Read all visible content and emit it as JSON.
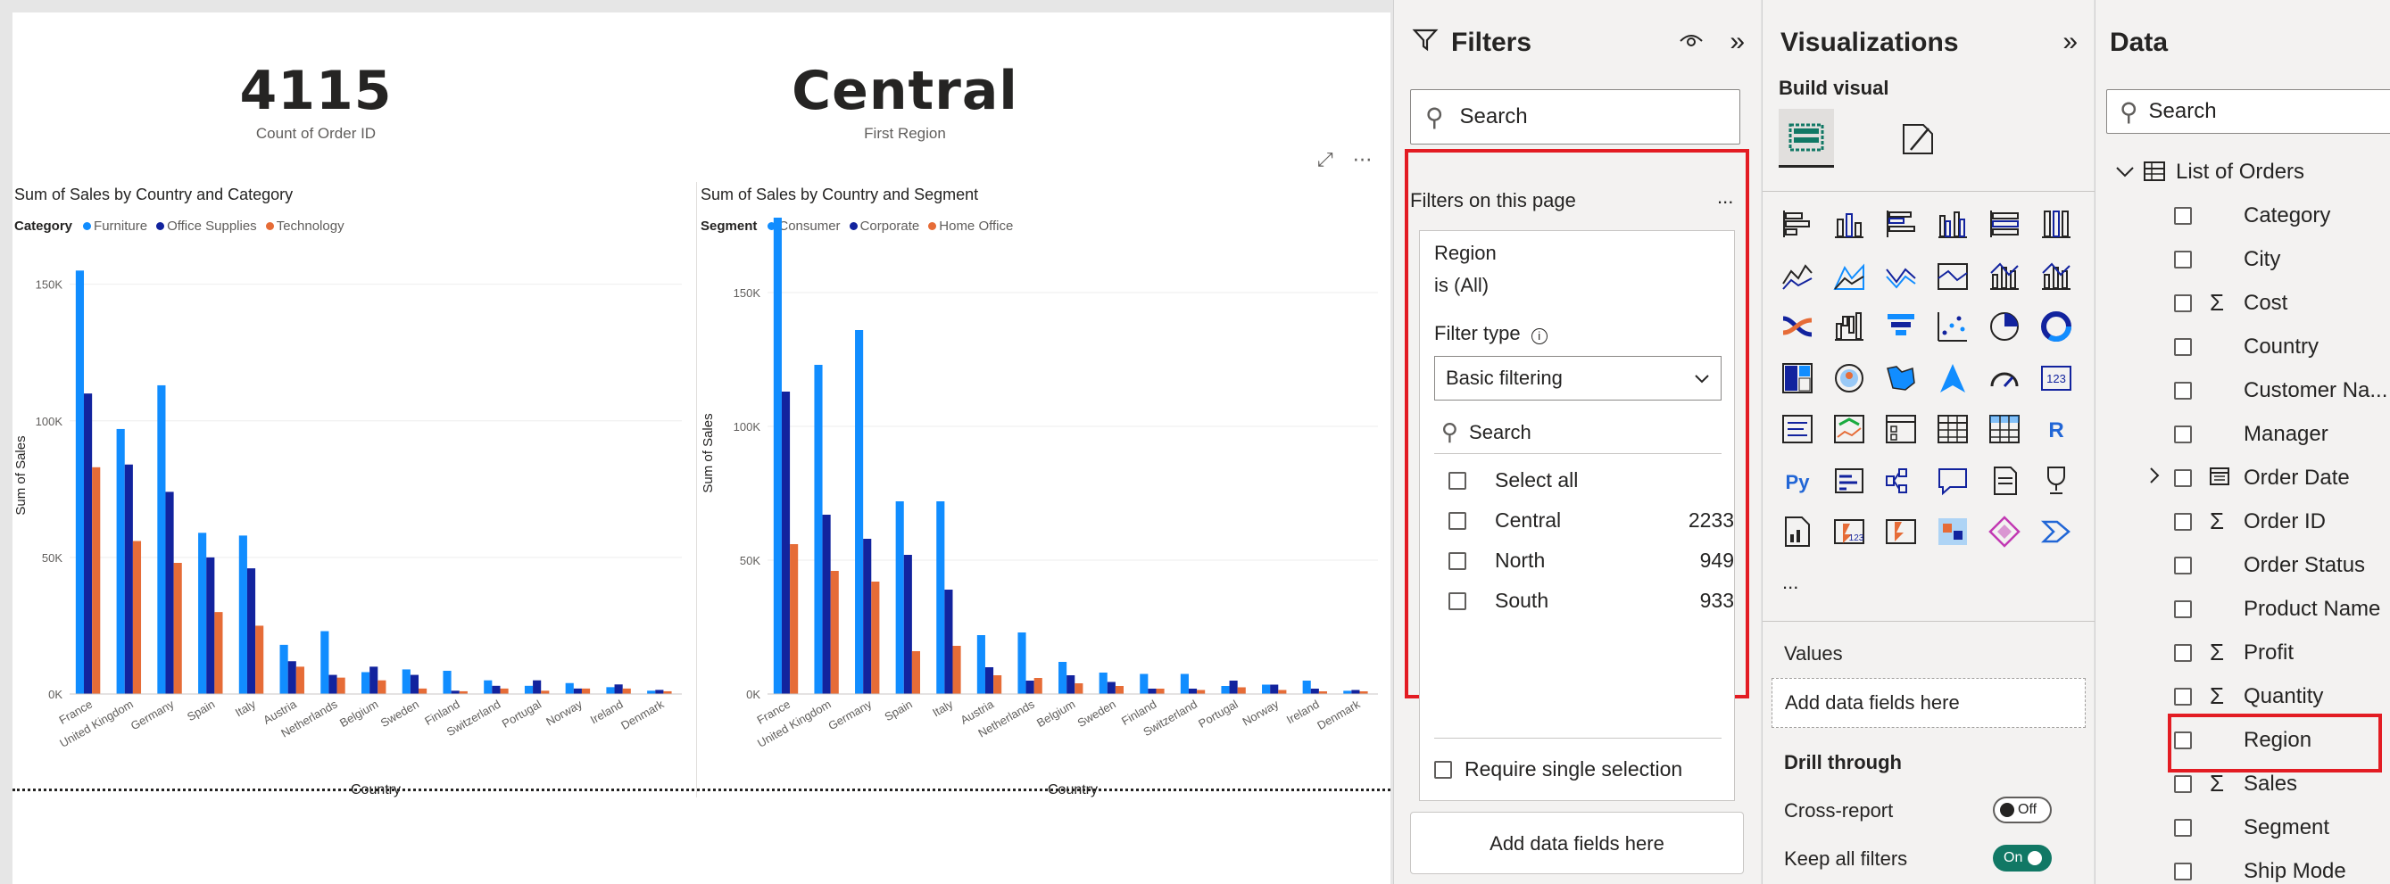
{
  "cards": [
    {
      "value": "4115",
      "label": "Count of Order ID"
    },
    {
      "value": "Central",
      "label": "First Region"
    }
  ],
  "colors": {
    "series1": "#118dff",
    "series2": "#12239e",
    "series3": "#e66c37",
    "accent_red": "#e31c23",
    "toggle_on": "#117865"
  },
  "chart_data": [
    {
      "type": "bar",
      "title": "Sum of Sales by Country and Category",
      "legend_title": "Category",
      "xlabel": "Country",
      "ylabel": "Sum of Sales",
      "ylim": [
        0,
        160000
      ],
      "yticks": [
        "0K",
        "50K",
        "100K",
        "150K"
      ],
      "categories": [
        "France",
        "United Kingdom",
        "Germany",
        "Spain",
        "Italy",
        "Austria",
        "Netherlands",
        "Belgium",
        "Sweden",
        "Finland",
        "Switzerland",
        "Portugal",
        "Norway",
        "Ireland",
        "Denmark"
      ],
      "series": [
        {
          "name": "Furniture",
          "values": [
            155000,
            97000,
            113000,
            59000,
            58000,
            18000,
            23000,
            8000,
            9000,
            8500,
            5000,
            3000,
            4000,
            2500,
            1200
          ]
        },
        {
          "name": "Office Supplies",
          "values": [
            110000,
            84000,
            74000,
            50000,
            46000,
            12000,
            7000,
            10000,
            7000,
            1200,
            3000,
            5000,
            2000,
            3500,
            1500
          ]
        },
        {
          "name": "Technology",
          "values": [
            83000,
            56000,
            48000,
            30000,
            25000,
            10000,
            6000,
            5000,
            2000,
            1000,
            2000,
            1200,
            2000,
            2000,
            1000
          ]
        }
      ]
    },
    {
      "type": "bar",
      "title": "Sum of Sales by Country and Segment",
      "legend_title": "Segment",
      "xlabel": "Country",
      "ylabel": "Sum of Sales",
      "ylim": [
        0,
        180000
      ],
      "yticks": [
        "0K",
        "50K",
        "100K",
        "150K"
      ],
      "categories": [
        "France",
        "United Kingdom",
        "Germany",
        "Spain",
        "Italy",
        "Austria",
        "Netherlands",
        "Belgium",
        "Sweden",
        "Finland",
        "Switzerland",
        "Portugal",
        "Norway",
        "Ireland",
        "Denmark"
      ],
      "series": [
        {
          "name": "Consumer",
          "values": [
            178000,
            123000,
            136000,
            72000,
            72000,
            22000,
            23000,
            12000,
            8000,
            7500,
            7500,
            3000,
            3500,
            5000,
            1200
          ]
        },
        {
          "name": "Corporate",
          "values": [
            113000,
            67000,
            58000,
            52000,
            39000,
            10000,
            5000,
            7000,
            4500,
            2000,
            2000,
            5000,
            3500,
            2000,
            1500
          ]
        },
        {
          "name": "Home Office",
          "values": [
            56000,
            46000,
            42000,
            16000,
            18000,
            7000,
            6000,
            4000,
            3000,
            2000,
            1500,
            2500,
            1500,
            1000,
            1000
          ]
        }
      ]
    }
  ],
  "filters": {
    "title": "Filters",
    "search_placeholder": "Search",
    "section_title": "Filters on this page",
    "more": "...",
    "card": {
      "field": "Region",
      "state": "is (All)",
      "filter_type_label": "Filter type",
      "filter_type_value": "Basic filtering",
      "search_placeholder": "Search",
      "select_all": "Select all",
      "items": [
        {
          "label": "Central",
          "count": "2233"
        },
        {
          "label": "North",
          "count": "949"
        },
        {
          "label": "South",
          "count": "933"
        }
      ],
      "require_single": "Require single selection"
    },
    "add_fields": "Add data fields here"
  },
  "visualizations": {
    "title": "Visualizations",
    "build_visual": "Build visual",
    "more": "...",
    "values_label": "Values",
    "add_fields": "Add data fields here",
    "drill_through": "Drill through",
    "cross_report": "Cross-report",
    "cross_report_state": "Off",
    "keep_all_filters": "Keep all filters",
    "keep_all_filters_state": "On",
    "r_glyph": "R",
    "py_glyph": "Py",
    "num_glyph": "123"
  },
  "data_pane": {
    "title": "Data",
    "search_placeholder": "Search",
    "table": "List of Orders",
    "fields": [
      {
        "name": "Category",
        "sigma": false
      },
      {
        "name": "City",
        "sigma": false
      },
      {
        "name": "Cost",
        "sigma": true
      },
      {
        "name": "Country",
        "sigma": false
      },
      {
        "name": "Customer Na...",
        "sigma": false
      },
      {
        "name": "Manager",
        "sigma": false
      },
      {
        "name": "Order Date",
        "sigma": false
      },
      {
        "name": "Order ID",
        "sigma": true
      },
      {
        "name": "Order Status",
        "sigma": false
      },
      {
        "name": "Product Name",
        "sigma": false
      },
      {
        "name": "Profit",
        "sigma": true
      },
      {
        "name": "Quantity",
        "sigma": true
      },
      {
        "name": "Region",
        "sigma": false
      },
      {
        "name": "Sales",
        "sigma": true
      },
      {
        "name": "Segment",
        "sigma": false
      },
      {
        "name": "Ship Mode",
        "sigma": false
      }
    ]
  },
  "icons": {
    "sigma": "Σ",
    "chevron_right": "›",
    "chevron_down": "⌄",
    "double_chevron": "»"
  }
}
